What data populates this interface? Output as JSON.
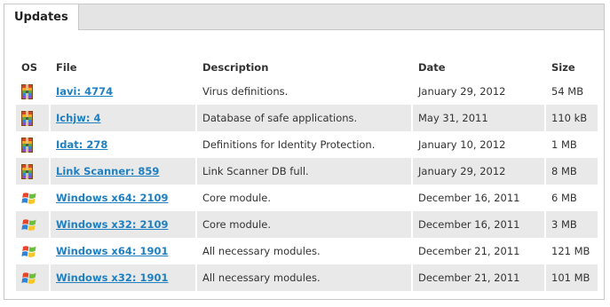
{
  "tab": {
    "label": "Updates"
  },
  "columns": {
    "os": "OS",
    "file": "File",
    "description": "Description",
    "date": "Date",
    "size": "Size"
  },
  "rows": [
    {
      "os_icon": "archive-icon",
      "file": "Iavi: 4774",
      "description": "Virus definitions.",
      "date": "January 29, 2012",
      "size": "54 MB"
    },
    {
      "os_icon": "archive-icon",
      "file": "Ichjw: 4",
      "description": "Database of safe applications.",
      "date": "May 31, 2011",
      "size": "110 kB"
    },
    {
      "os_icon": "archive-icon",
      "file": "Idat: 278",
      "description": "Definitions for Identity Protection.",
      "date": "January 10, 2012",
      "size": "1 MB"
    },
    {
      "os_icon": "archive-icon",
      "file": "Link Scanner: 859",
      "description": "Link Scanner DB full.",
      "date": "January 29, 2012",
      "size": "8 MB"
    },
    {
      "os_icon": "windows-icon",
      "file": "Windows x64: 2109",
      "description": "Core module.",
      "date": "December 16, 2011",
      "size": "6 MB"
    },
    {
      "os_icon": "windows-icon",
      "file": "Windows x32: 2109",
      "description": "Core module.",
      "date": "December 16, 2011",
      "size": "3 MB"
    },
    {
      "os_icon": "windows-icon",
      "file": "Windows x64: 1901",
      "description": "All necessary modules.",
      "date": "December 21, 2011",
      "size": "121 MB"
    },
    {
      "os_icon": "windows-icon",
      "file": "Windows x32: 1901",
      "description": "All necessary modules.",
      "date": "December 21, 2011",
      "size": "101 MB"
    }
  ],
  "colors": {
    "link": "#1f7fc0",
    "stripe": "#e9e9e9",
    "tabbar": "#e4e4e4"
  }
}
